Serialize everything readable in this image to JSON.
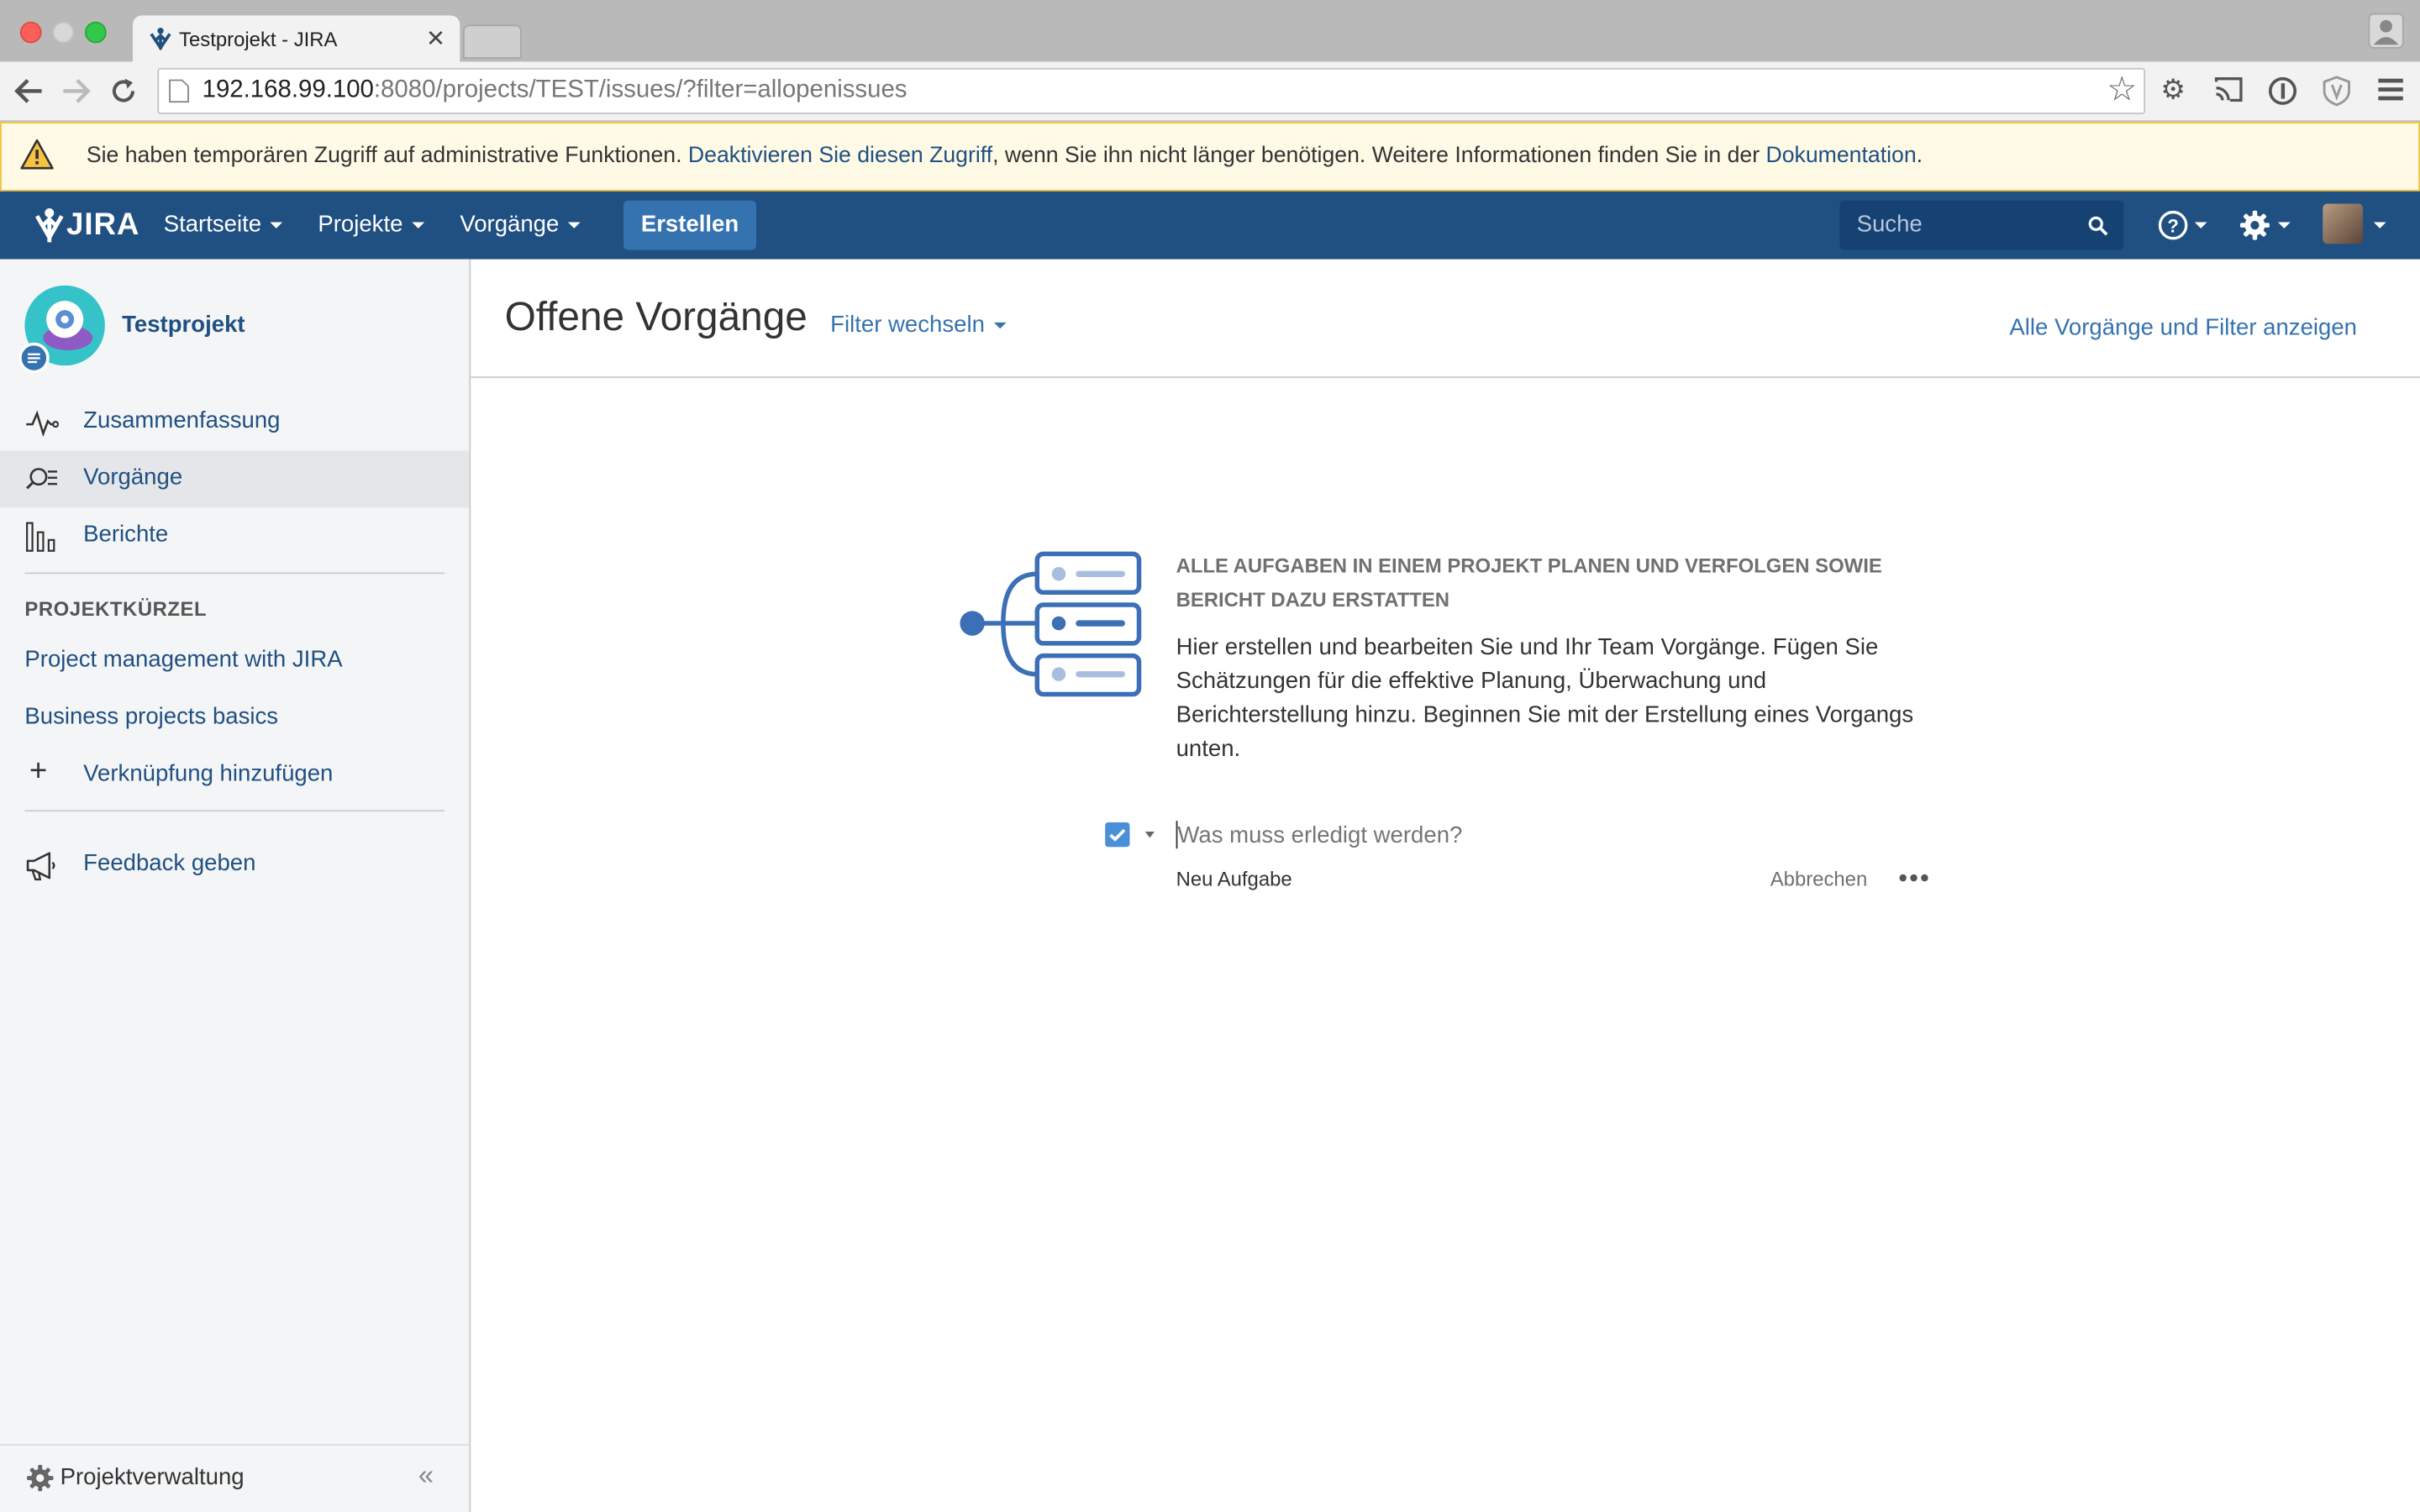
{
  "browser": {
    "tab_title": "Testprojekt - JIRA",
    "url_host": "192.168.99.100",
    "url_rest": ":8080/projects/TEST/issues/?filter=allopenissues"
  },
  "warning": {
    "text_before": "Sie haben temporären Zugriff auf administrative Funktionen. ",
    "link1": "Deaktivieren Sie diesen Zugriff",
    "text_middle": ", wenn Sie ihn nicht länger benötigen. Weitere Informationen finden Sie in der ",
    "link2": "Dokumentation",
    "text_after": "."
  },
  "header": {
    "logo": "JIRA",
    "nav": [
      "Startseite",
      "Projekte",
      "Vorgänge"
    ],
    "create_label": "Erstellen",
    "search_placeholder": "Suche"
  },
  "sidebar": {
    "project_name": "Testprojekt",
    "items": [
      {
        "label": "Zusammenfassung",
        "icon": "activity-icon"
      },
      {
        "label": "Vorgänge",
        "icon": "issues-icon"
      },
      {
        "label": "Berichte",
        "icon": "reports-icon"
      }
    ],
    "shortcuts_heading": "PROJEKTKÜRZEL",
    "shortcuts": [
      "Project management with JIRA",
      "Business projects basics"
    ],
    "add_shortcut": "Verknüpfung hinzufügen",
    "feedback": "Feedback geben",
    "footer": "Projektverwaltung"
  },
  "main": {
    "title": "Offene Vorgänge",
    "filter_switch": "Filter wechseln",
    "all_filters_link": "Alle Vorgänge und Filter anzeigen",
    "empty_heading_line1": "ALLE AUFGABEN IN EINEM PROJEKT PLANEN UND VERFOLGEN SOWIE",
    "empty_heading_line2": "BERICHT DAZU ERSTATTEN",
    "empty_body_lines": [
      "Hier erstellen und bearbeiten Sie und Ihr Team Vorgänge. Fügen Sie",
      "Schätzungen für die effektive Planung, Überwachung und",
      "Berichterstellung hinzu. Beginnen Sie mit der Erstellung eines Vorgangs",
      "unten."
    ],
    "inline_create_placeholder": "Was muss erledigt werden?",
    "issue_type": "Neu Aufgabe",
    "cancel": "Abbrechen"
  },
  "colors": {
    "header_bg": "#205081",
    "link": "#205081",
    "create_button": "#3572b0",
    "warning_bg": "#fffae6"
  }
}
